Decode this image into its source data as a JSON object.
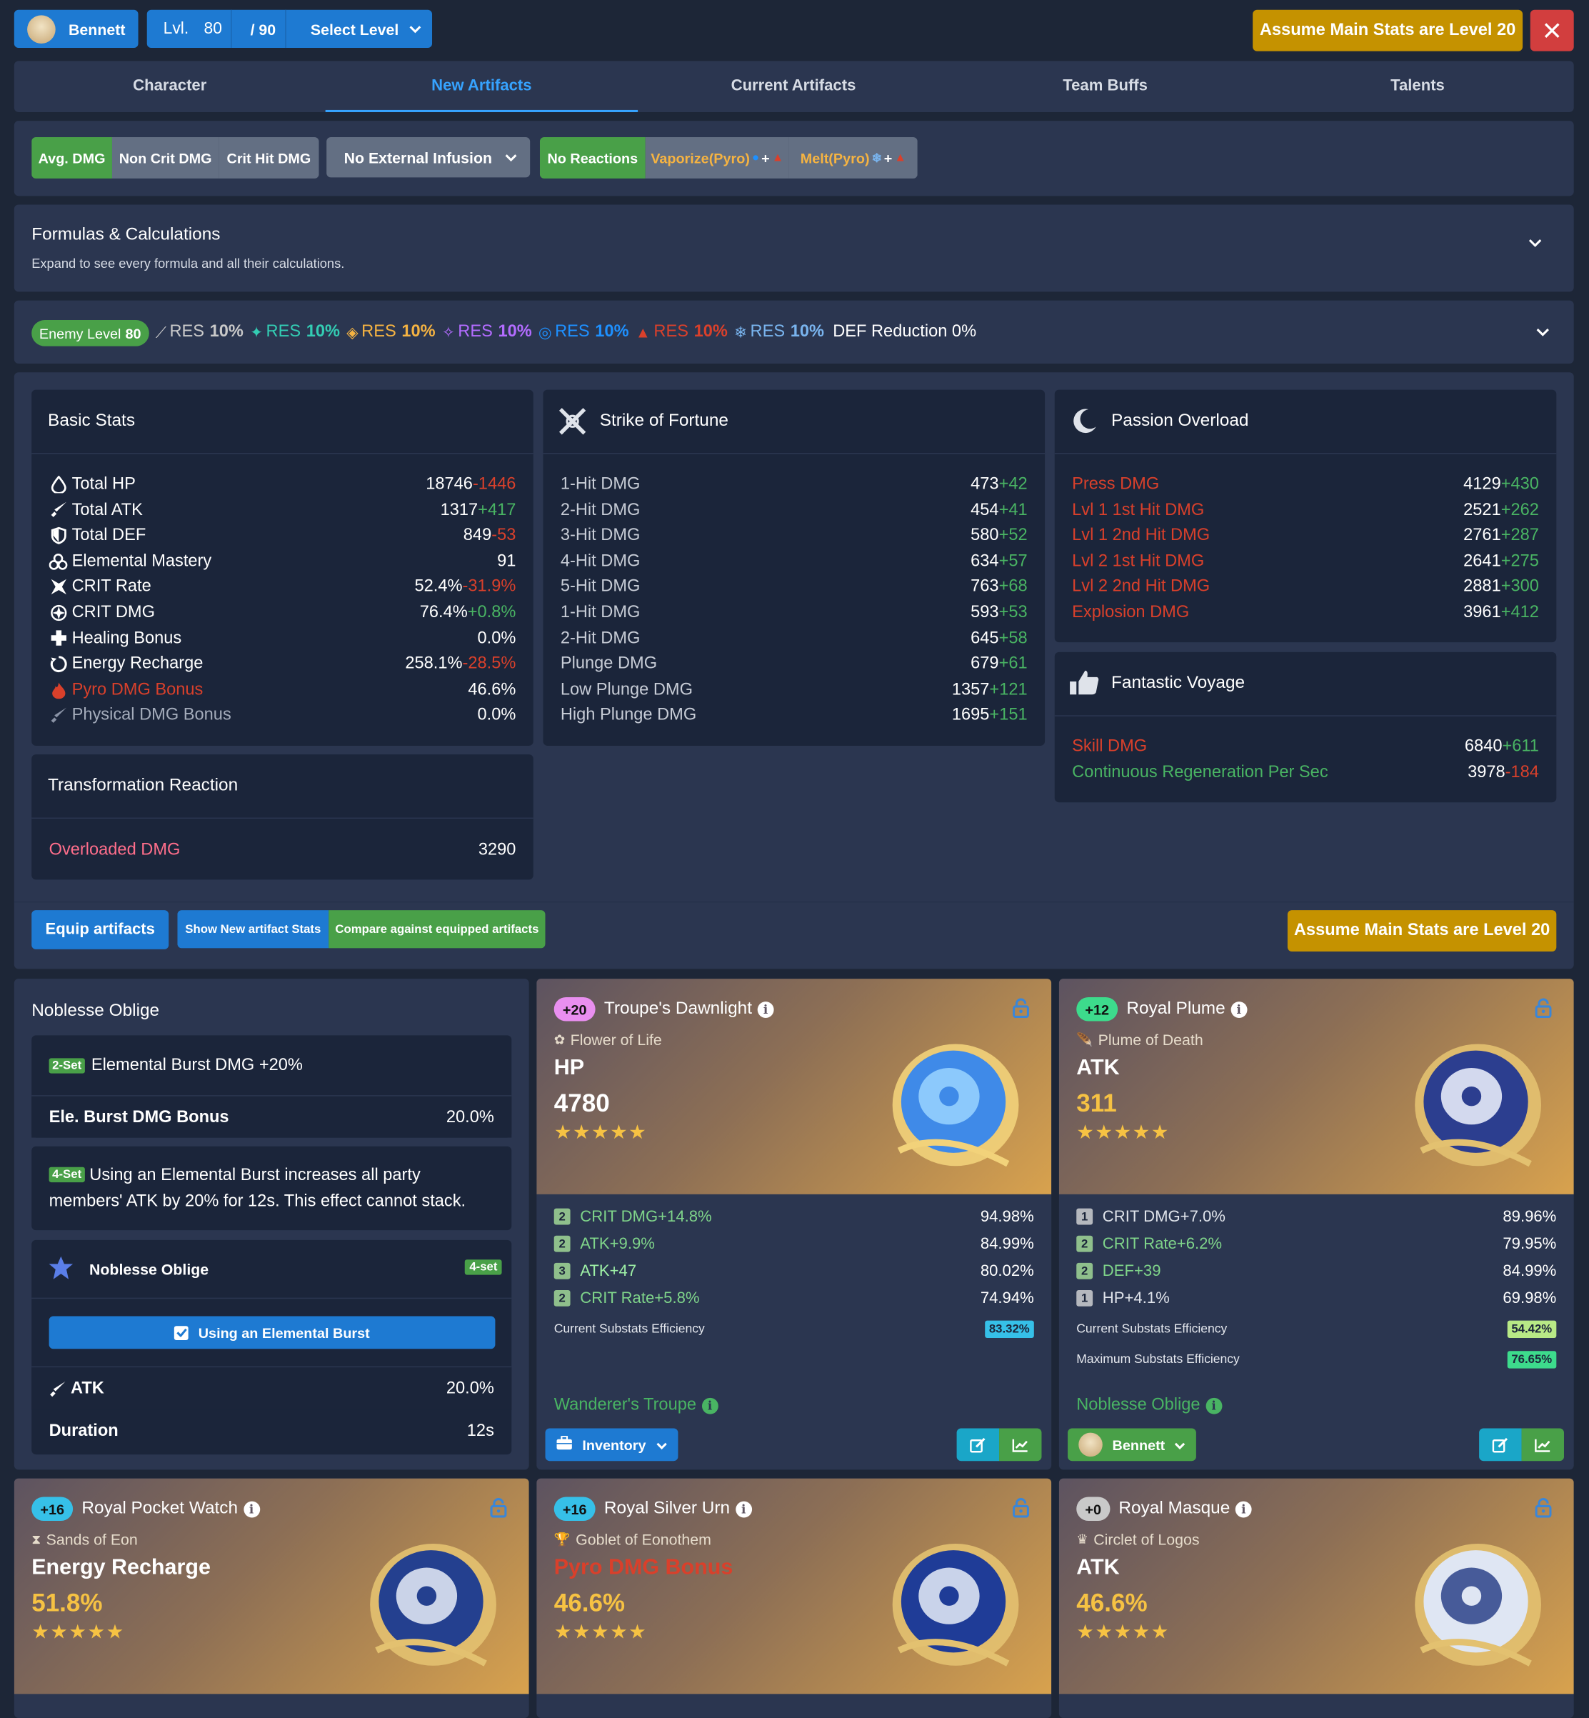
{
  "top": {
    "character": "Bennett",
    "lvl_label": "Lvl.",
    "level": "80",
    "max_level": "/ 90",
    "select_level": "Select Level",
    "assume_main": "Assume Main Stats are Level 20"
  },
  "tabs": [
    "Character",
    "New Artifacts",
    "Current Artifacts",
    "Team Buffs",
    "Talents"
  ],
  "toggles": {
    "avg": "Avg. DMG",
    "noncrit": "Non Crit DMG",
    "crit": "Crit Hit DMG",
    "infusion": "No External Infusion",
    "no_reactions": "No Reactions",
    "vaporize": "Vaporize(Pyro)",
    "melt": "Melt(Pyro)"
  },
  "formulas": {
    "title": "Formulas & Calculations",
    "subtitle": "Expand to see every formula and all their calculations."
  },
  "enemy": {
    "level_label": "Enemy Level",
    "level": "80",
    "res": [
      {
        "label": "RES",
        "value": "10%",
        "color": "#c9c9c9"
      },
      {
        "label": "RES",
        "value": "10%",
        "color": "#33ccb3"
      },
      {
        "label": "RES",
        "value": "10%",
        "color": "#f5b342"
      },
      {
        "label": "RES",
        "value": "10%",
        "color": "#b36cff"
      },
      {
        "label": "RES",
        "value": "10%",
        "color": "#1e90ff"
      },
      {
        "label": "RES",
        "value": "10%",
        "color": "#d9402b"
      },
      {
        "label": "RES",
        "value": "10%",
        "color": "#79b4ee"
      }
    ],
    "def_reduction": "DEF Reduction 0%"
  },
  "basic_stats": {
    "title": "Basic Stats",
    "rows": [
      {
        "label": "Total HP",
        "value": "18746",
        "diff": "-1446",
        "pos": false
      },
      {
        "label": "Total ATK",
        "value": "1317",
        "diff": "+417",
        "pos": true
      },
      {
        "label": "Total DEF",
        "value": "849",
        "diff": "-53",
        "pos": false
      },
      {
        "label": "Elemental Mastery",
        "value": "91",
        "diff": "",
        "pos": true
      },
      {
        "label": "CRIT Rate",
        "value": "52.4%",
        "diff": "-31.9%",
        "pos": false
      },
      {
        "label": "CRIT DMG",
        "value": "76.4%",
        "diff": "+0.8%",
        "pos": true
      },
      {
        "label": "Healing Bonus",
        "value": "0.0%",
        "diff": "",
        "pos": true
      },
      {
        "label": "Energy Recharge",
        "value": "258.1%",
        "diff": "-28.5%",
        "pos": false
      },
      {
        "label": "Pyro DMG Bonus",
        "value": "46.6%",
        "diff": "",
        "pos": true
      },
      {
        "label": "Physical DMG Bonus",
        "value": "0.0%",
        "diff": "",
        "pos": true
      }
    ]
  },
  "transformation": {
    "title": "Transformation Reaction",
    "label": "Overloaded DMG",
    "value": "3290"
  },
  "strike": {
    "title": "Strike of Fortune",
    "rows": [
      {
        "label": "1-Hit DMG",
        "value": "473",
        "diff": "+42"
      },
      {
        "label": "2-Hit DMG",
        "value": "454",
        "diff": "+41"
      },
      {
        "label": "3-Hit DMG",
        "value": "580",
        "diff": "+52"
      },
      {
        "label": "4-Hit DMG",
        "value": "634",
        "diff": "+57"
      },
      {
        "label": "5-Hit DMG",
        "value": "763",
        "diff": "+68"
      },
      {
        "label": "1-Hit DMG",
        "value": "593",
        "diff": "+53"
      },
      {
        "label": "2-Hit DMG",
        "value": "645",
        "diff": "+58"
      },
      {
        "label": "Plunge DMG",
        "value": "679",
        "diff": "+61"
      },
      {
        "label": "Low Plunge DMG",
        "value": "1357",
        "diff": "+121"
      },
      {
        "label": "High Plunge DMG",
        "value": "1695",
        "diff": "+151"
      }
    ]
  },
  "passion": {
    "title": "Passion Overload",
    "rows": [
      {
        "label": "Press DMG",
        "value": "4129",
        "diff": "+430"
      },
      {
        "label": "Lvl 1 1st Hit DMG",
        "value": "2521",
        "diff": "+262"
      },
      {
        "label": "Lvl 1 2nd Hit DMG",
        "value": "2761",
        "diff": "+287"
      },
      {
        "label": "Lvl 2 1st Hit DMG",
        "value": "2641",
        "diff": "+275"
      },
      {
        "label": "Lvl 2 2nd Hit DMG",
        "value": "2881",
        "diff": "+300"
      },
      {
        "label": "Explosion DMG",
        "value": "3961",
        "diff": "+412"
      }
    ]
  },
  "voyage": {
    "title": "Fantastic Voyage",
    "rows": [
      {
        "label": "Skill DMG",
        "value": "6840",
        "diff": "+611",
        "color": "#d9402b",
        "pos": true
      },
      {
        "label": "Continuous Regeneration Per Sec",
        "value": "3978",
        "diff": "-184",
        "color": "#49b463",
        "pos": false
      }
    ]
  },
  "actions": {
    "equip": "Equip artifacts",
    "show_new": "Show New artifact Stats",
    "compare": "Compare against equipped artifacts",
    "assume_main": "Assume Main Stats are Level 20"
  },
  "set": {
    "name": "Noblesse Oblige",
    "two_badge": "2-Set",
    "two_text": "Elemental Burst DMG +20%",
    "two_stat_label": "Ele. Burst DMG Bonus",
    "two_stat_value": "20.0%",
    "four_badge": "4-Set",
    "four_text": "Using an Elemental Burst increases all party members' ATK by 20% for 12s. This effect cannot stack.",
    "cond_title": "Noblesse Oblige",
    "cond_badge": "4-set",
    "cond_button": "Using an Elemental Burst",
    "atk_label": "ATK",
    "atk_value": "20.0%",
    "duration_label": "Duration",
    "duration_value": "12s"
  },
  "artifacts": [
    {
      "level": "+20",
      "level_color": "#e98ff0",
      "name": "Troupe's Dawnlight",
      "slot": "Flower of Life",
      "main_stat": "HP",
      "main_value": "4780",
      "main_color": "#ffffff",
      "value_color": "#ffffff",
      "subs": [
        {
          "rank": "2",
          "text": "CRIT DMG+14.8%",
          "eff": "94.98%"
        },
        {
          "rank": "2",
          "text": "ATK+9.9%",
          "eff": "84.99%"
        },
        {
          "rank": "3",
          "text": "ATK+47",
          "eff": "80.02%"
        },
        {
          "rank": "2",
          "text": "CRIT Rate+5.8%",
          "eff": "74.94%"
        }
      ],
      "cur_eff_label": "Current Substats Efficiency",
      "cur_eff": "83.32%",
      "cur_eff_color": "#36c0e8",
      "set": "Wanderer's Troupe",
      "location": "Inventory"
    },
    {
      "level": "+12",
      "level_color": "#3ddb8c",
      "name": "Royal Plume",
      "slot": "Plume of Death",
      "main_stat": "ATK",
      "main_value": "311",
      "main_color": "#ffffff",
      "value_color": "#f6c243",
      "subs": [
        {
          "rank": "1",
          "text": "CRIT DMG+7.0%",
          "eff": "89.96%"
        },
        {
          "rank": "2",
          "text": "CRIT Rate+6.2%",
          "eff": "79.95%"
        },
        {
          "rank": "2",
          "text": "DEF+39",
          "eff": "84.99%"
        },
        {
          "rank": "1",
          "text": "HP+4.1%",
          "eff": "69.98%"
        }
      ],
      "cur_eff_label": "Current Substats Efficiency",
      "cur_eff": "54.42%",
      "cur_eff_color": "#b8e986",
      "max_eff_label": "Maximum Substats Efficiency",
      "max_eff": "76.65%",
      "max_eff_color": "#3ddb8c",
      "set": "Noblesse Oblige",
      "location": "Bennett"
    },
    {
      "level": "+16",
      "level_color": "#36c0e8",
      "name": "Royal Pocket Watch",
      "slot": "Sands of Eon",
      "main_stat": "Energy Recharge",
      "main_value": "51.8%",
      "main_color": "#ffffff",
      "value_color": "#f6c243"
    },
    {
      "level": "+16",
      "level_color": "#36c0e8",
      "name": "Royal Silver Urn",
      "slot": "Goblet of Eonothem",
      "main_stat": "Pyro DMG Bonus",
      "main_value": "46.6%",
      "main_color": "#d9402b",
      "value_color": "#f6c243"
    },
    {
      "level": "+0",
      "level_color": "#c9c9c9",
      "name": "Royal Masque",
      "slot": "Circlet of Logos",
      "main_stat": "ATK",
      "main_value": "46.6%",
      "main_color": "#ffffff",
      "value_color": "#f6c243"
    }
  ],
  "icons": [
    "avatar-icon",
    "chevron-down-icon",
    "close-icon",
    "lock-icon",
    "info-icon",
    "edit-icon",
    "chart-icon",
    "briefcase-icon",
    "check-icon",
    "hp-icon",
    "sword-icon",
    "shield-icon",
    "em-icon",
    "crit-rate-icon",
    "crit-dmg-icon",
    "heal-icon",
    "er-icon",
    "pyro-icon",
    "physical-icon"
  ]
}
